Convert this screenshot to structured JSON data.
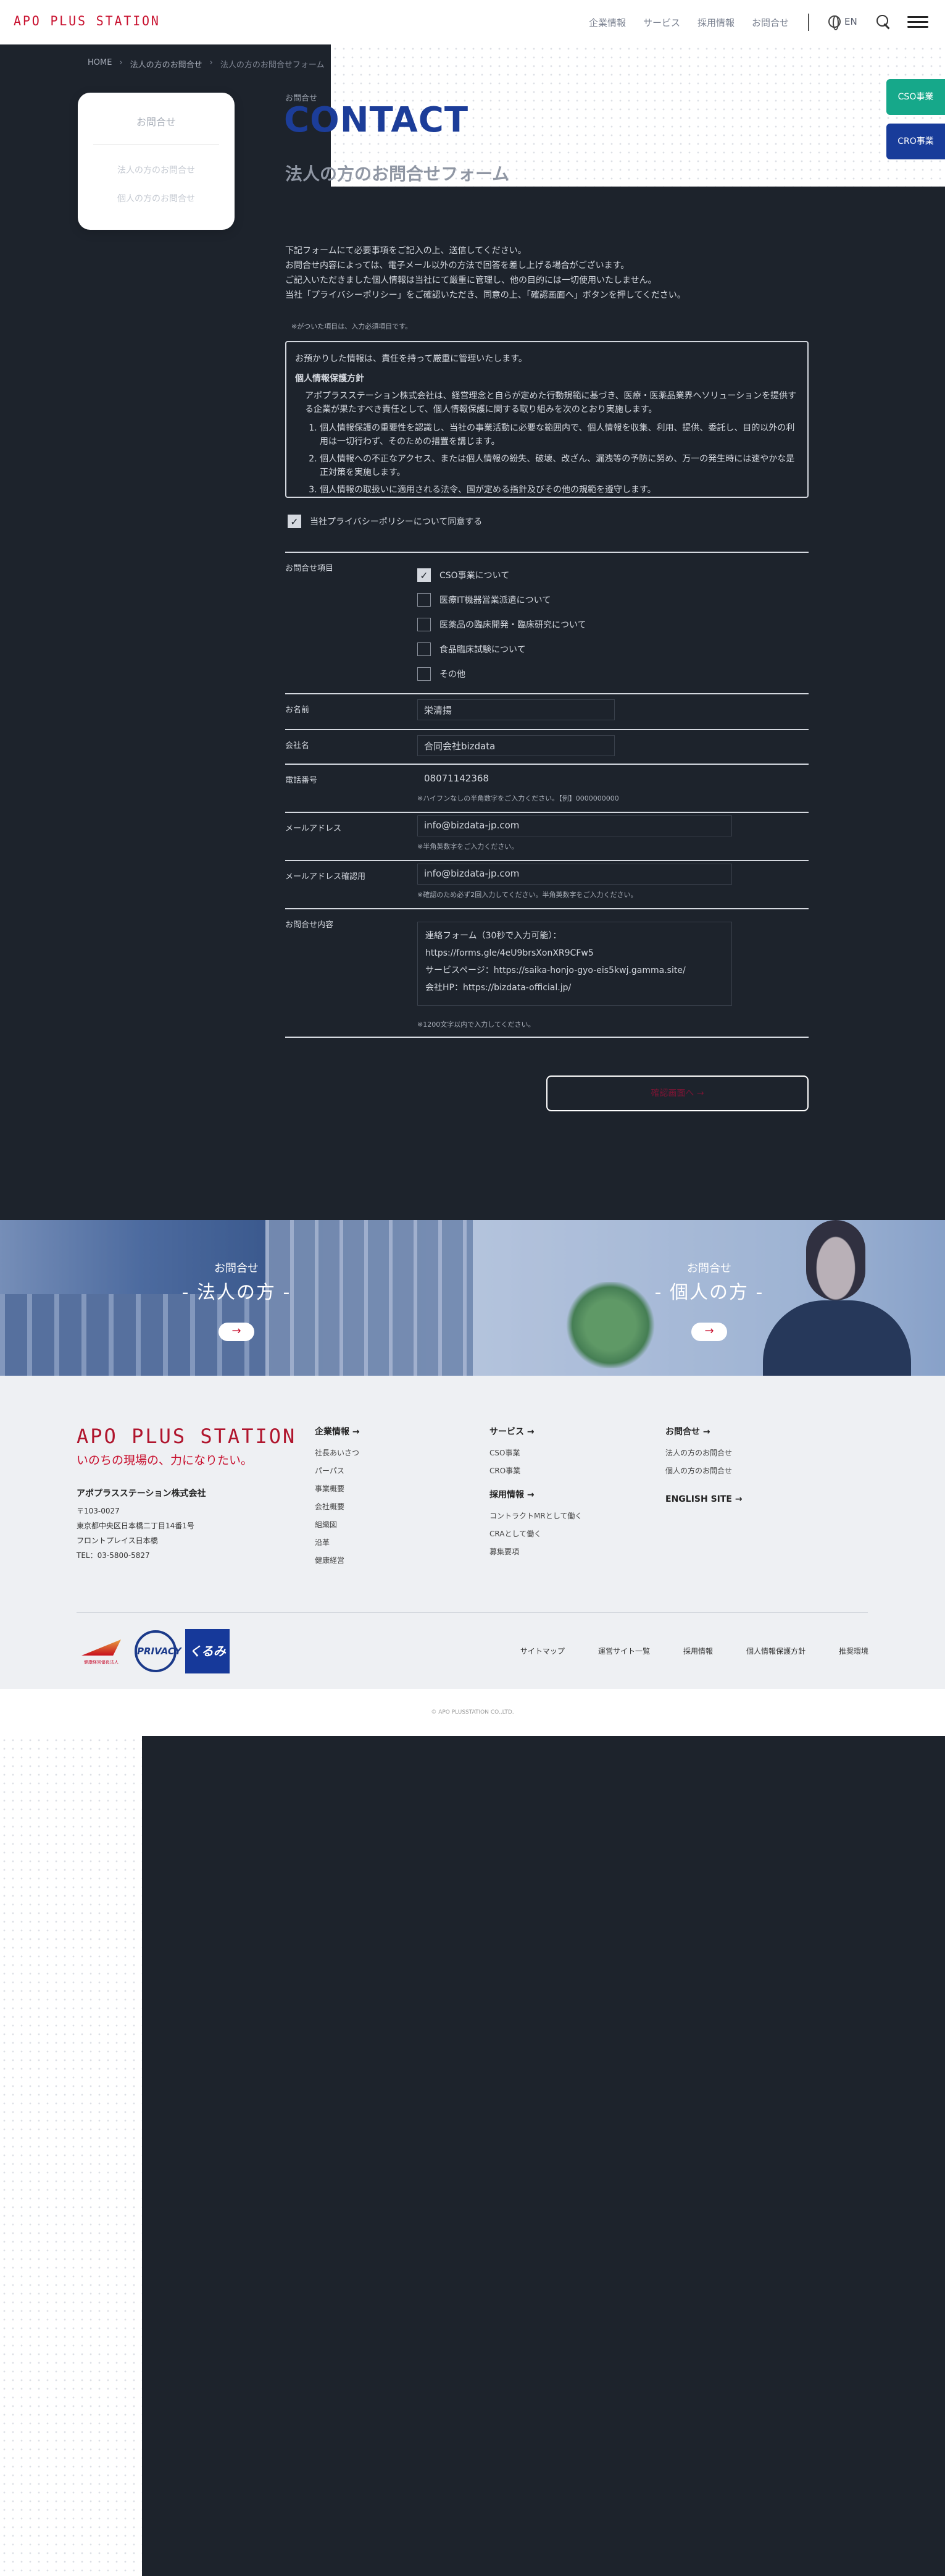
{
  "header": {
    "logo": "APO PLUS STATION",
    "nav": [
      "企業情報",
      "サービス",
      "採用情報",
      "お問合せ"
    ],
    "lang": "EN",
    "icons": {
      "search": "search-icon",
      "menu": "menu-icon",
      "globe": "globe-icon"
    }
  },
  "breadcrumb": [
    "HOME",
    "法人の方のお問合せ",
    "法人の方のお問合せフォーム"
  ],
  "side_nav": {
    "title": "お問合せ",
    "items": [
      "法人の方のお問合せ",
      "個人の方のお問合せ"
    ]
  },
  "page": {
    "subtitle": "お問合せ",
    "title": "CONTACT",
    "form_title": "法人の方のお問合せフォーム",
    "intro": [
      "下記フォームにて必要事項をご記入の上、送信してください。",
      "お問合せ内容によっては、電子メール以外の方法で回答を差し上げる場合がございます。",
      "ご記入いただきました個人情報は当社にて厳重に管理し、他の目的には一切使用いたしません。",
      "当社「プライバシーポリシー」をご確認いただき、同意の上、「確認画面へ」ボタンを押してください。"
    ],
    "required_note": "※がついた項目は、入力必須項目です。"
  },
  "policy": {
    "line1": "お預かりした情報は、責任を持って厳重に管理いたします。",
    "heading": "個人情報保護方針",
    "para": "アポプラスステーション株式会社は、経営理念と自らが定めた行動規範に基づき、医療・医薬品業界ヘソリューションを提供する企業が果たすべき責任として、個人情報保護に関する取り組みを次のとおり実施します。",
    "items": [
      "個人情報保護の重要性を認識し、当社の事業活動に必要な範囲内で、個人情報を収集、利用、提供、委託し、目的以外の利用は一切行わず、そのための措置を講じます。",
      "個人情報への不正なアクセス、または個人情報の紛失、破壊、改ざん、漏洩等の予防に努め、万一の発生時には速やかな是正対策を実施します。",
      "個人情報の取扱いに適用される法令、国が定める指針及びその他の規範を遵守します。"
    ]
  },
  "agree": {
    "label": "当社プライバシーポリシーについて同意する",
    "checked": true
  },
  "form": {
    "topic_label": "お問合せ項目",
    "topics": [
      {
        "label": "CSO事業について",
        "checked": true
      },
      {
        "label": "医療IT機器営業派遣について",
        "checked": false
      },
      {
        "label": "医薬品の臨床開発・臨床研究について",
        "checked": false
      },
      {
        "label": "食品臨床試験について",
        "checked": false
      },
      {
        "label": "その他",
        "checked": false
      }
    ],
    "name_label": "お名前",
    "name_value": "栄清揚",
    "company_label": "会社名",
    "company_value": "合同会社bizdata",
    "tel_label": "電話番号",
    "tel_value": "08071142368",
    "tel_note": "※ハイフンなしの半角数字をご入力ください。【例】0000000000",
    "email_label": "メールアドレス",
    "email_value": "info@bizdata-jp.com",
    "email_note": "※半角英数字をご入力ください。",
    "email2_label": "メールアドレス確認用",
    "email2_value": "info@bizdata-jp.com",
    "email2_note": "※確認のため必ず2回入力してください。半角英数字をご入力ください。",
    "message_label": "お問合せ内容",
    "message_lines": [
      "連絡フォーム（30秒で入力可能）：",
      "https://forms.gle/4eU9brsXonXR9CFw5",
      "サービスページ：https://saika-honjo-gyo-eis5kwj.gamma.site/",
      "会社HP：https://bizdata-official.jp/"
    ],
    "message_note": "※1200文字以内で入力してください。",
    "submit": "確認画面へ →"
  },
  "side_buttons": {
    "cso": "CSO事業",
    "cro": "CRO事業"
  },
  "banners": [
    {
      "sub": "お問合せ",
      "title": "- 法人の方 -",
      "arrow": "→"
    },
    {
      "sub": "お問合せ",
      "title": "- 個人の方 -",
      "arrow": "→"
    }
  ],
  "footer": {
    "logo": "APO PLUS STATION",
    "tagline": "いのちの現場の、力になりたい。",
    "company": "アポプラスステーション株式会社",
    "zip": "〒103-0027",
    "addr1": "東京都中央区日本橋二丁目14番1号",
    "addr2": "フロントプレイス日本橋",
    "tel": "TEL：03-5800-5827",
    "col1": {
      "heading": "企業情報 →",
      "items": [
        "社長あいさつ",
        "パーパス",
        "事業概要",
        "会社概要",
        "組織図",
        "沿革",
        "健康経営"
      ]
    },
    "col2": {
      "heading": "サービス →",
      "items": [
        "CSO事業",
        "CRO事業"
      ],
      "heading2": "採用情報 →",
      "items2": [
        "コントラクトMRとして働く",
        "CRAとして働く",
        "募集要項"
      ]
    },
    "col3": {
      "heading": "お問合せ →",
      "items": [
        "法人の方のお問合せ",
        "個人の方のお問合せ"
      ],
      "heading2": "ENGLISH SITE →"
    },
    "badges": {
      "b1": "健康経営優良法人",
      "b2": "PRIVACY",
      "b3": "くるみん"
    },
    "links": [
      "サイトマップ",
      "運営サイト一覧",
      "採用情報",
      "個人情報保護方針",
      "推奨環境"
    ],
    "copyright": "© APO PLUSSTATION CO.,LTD."
  }
}
